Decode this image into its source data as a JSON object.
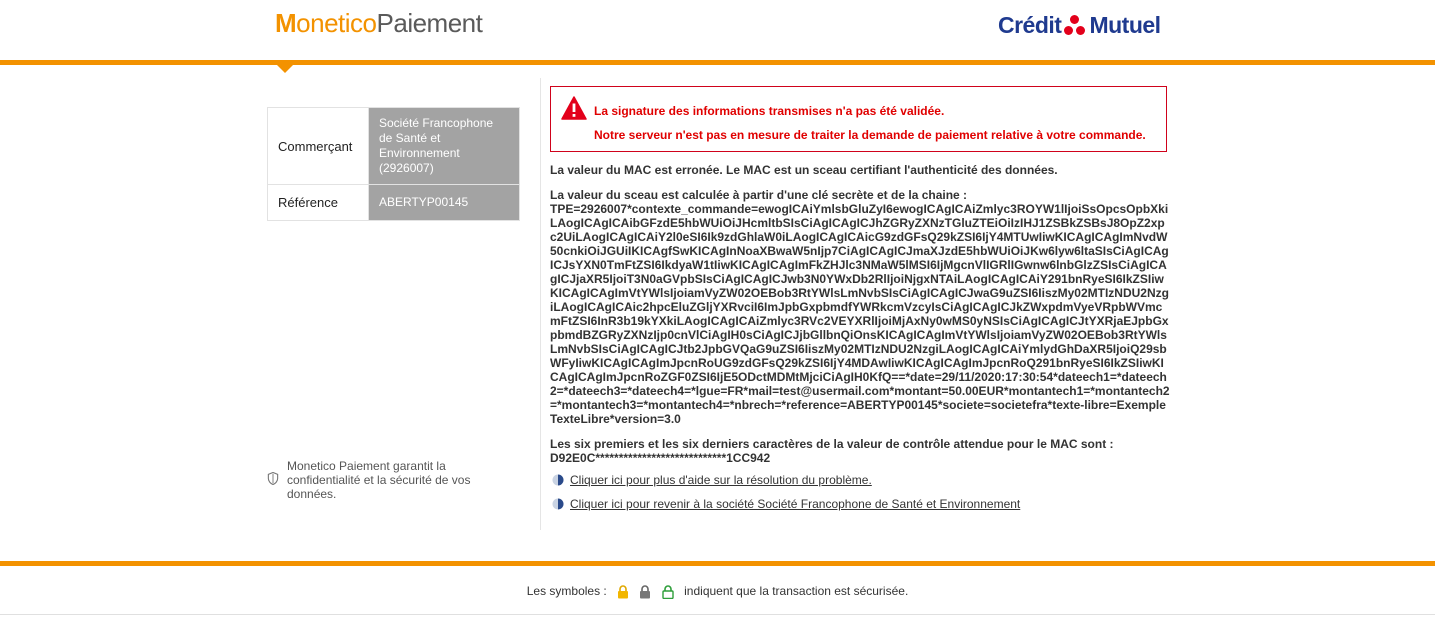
{
  "header": {
    "logo_monetico_prefix": "M",
    "logo_monetico_rest": "onetico",
    "logo_monetico_suffix": "Paiement",
    "logo_cm_left": "Crédit",
    "logo_cm_right": "Mutuel"
  },
  "merchant": {
    "rows": [
      {
        "label": "Commerçant",
        "value": "Société Francophone de Santé et Environnement (2926007)"
      },
      {
        "label": "Référence",
        "value": "ABERTYP00145"
      }
    ]
  },
  "privacy_text": "Monetico Paiement garantit la confidentialité et la sécurité de vos données.",
  "error": {
    "line1": "La signature des informations transmises n'a pas été validée.",
    "line2": "Notre serveur n'est pas en mesure de traiter la demande de paiement relative à votre commande."
  },
  "content": {
    "mac_error": "La valeur du MAC est erronée. Le MAC est un sceau certifiant l'authenticité des données.",
    "seal_intro": "La valeur du sceau est calculée à partir d'une clé secrète et de la chaine :",
    "seal_chain": "TPE=2926007*contexte_commande=ewogICAiYmlsbGluZyI6ewogICAgICAiZmlyc3ROYW1lIjoiSsOpcsOpbXkiLAogICAgICAibGFzdE5hbWUiOiJHcmltbSIsCiAgICAgICJhZGRyZXNzTGluZTEiOiIzIHJ1ZSBkZSBsJ8OpZ2xpc2UiLAogICAgICAiY2l0eSI6Ik9zdGhlaW0iLAogICAgICAicG9zdGFsQ29kZSI6IjY4MTUwIiwKICAgICAgImNvdW50cnkiOiJGUiIKICAgfSwKICAgInNoaXBwaW5nIjp7CiAgICAgICJmaXJzdE5hbWUiOiJKw6lyw6ltaSIsCiAgICAgICJsYXN0TmFtZSI6IkdyaW1tIiwKICAgICAgImFkZHJlc3NMaW5lMSI6IjMgcnVlIGRlIGwnw6lnbGlzZSIsCiAgICAgICJjaXR5IjoiT3N0aGVpbSIsCiAgICAgICJwb3N0YWxDb2RlIjoiNjgxNTAiLAogICAgICAiY291bnRyeSI6IkZSIiwKICAgICAgImVtYWlsIjoiamVyZW02OEBob3RtYWlsLmNvbSIsCiAgICAgICJwaG9uZSI6IiszMy02MTIzNDU2NzgiLAogICAgICAic2hpcEluZGljYXRvciI6ImJpbGxpbmdfYWRkcmVzcyIsCiAgICAgICJkZWxpdmVyeVRpbWVmcmFtZSI6InR3b19kYXkiLAogICAgICAiZmlyc3RVc2VEYXRlIjoiMjAxNy0wMS0yNSIsCiAgICAgICJtYXRjaEJpbGxpbmdBZGRyZXNzIjp0cnVlCiAgIH0sCiAgICJjbGllbnQiOnsKICAgICAgImVtYWlsIjoiamVyZW02OEBob3RtYWlsLmNvbSIsCiAgICAgICJtb2JpbGVQaG9uZSI6IiszMy02MTIzNDU2NzgiLAogICAgICAiYmlydGhDaXR5IjoiQ29sbWFyIiwKICAgICAgImJpcnRoUG9zdGFsQ29kZSI6IjY4MDAwIiwKICAgICAgImJpcnRoQ291bnRyeSI6IkZSIiwKICAgICAgImJpcnRoZGF0ZSI6IjE5ODctMDMtMjciCiAgIH0KfQ==*date=29/11/2020:17:30:54*dateech1=*dateech2=*dateech3=*dateech4=*lgue=FR*mail=test@usermail.com*montant=50.00EUR*montantech1=*montantech2=*montantech3=*montantech4=*nbrech=*reference=ABERTYP00145*societe=societefra*texte-libre=ExempleTexteLibre*version=3.0",
    "control_intro": "Les six premiers et les six derniers caractères de la valeur de contrôle attendue pour le MAC sont :",
    "control_value": "D92E0C****************************1CC942"
  },
  "links": {
    "help": "Cliquer ici pour plus d'aide sur la résolution du problème.",
    "back": "Cliquer ici pour revenir à la société Société Francophone de Santé et Environnement"
  },
  "footer": {
    "prefix": "Les symboles :",
    "suffix": "indiquent que la transaction est sécurisée."
  }
}
